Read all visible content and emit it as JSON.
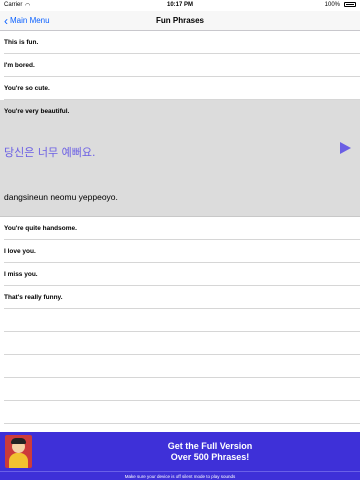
{
  "status_bar": {
    "carrier": "Carrier",
    "wifi_icon": "wifi-icon",
    "time": "10:17 PM",
    "battery": "100%"
  },
  "nav": {
    "back_label": "Main Menu",
    "title": "Fun Phrases"
  },
  "phrases_before": [
    "This is fun.",
    "I'm bored.",
    "You're so cute."
  ],
  "selected": {
    "english": "You're very beautiful.",
    "korean": "당신은 너무 예뻐요.",
    "romanization": "dangsineun neomu yeppeoyo.",
    "play_icon": "play-icon",
    "accent_color": "#6b5fe4"
  },
  "phrases_after": [
    "You're quite handsome.",
    "I love you.",
    "I miss you.",
    "That's really funny."
  ],
  "ad": {
    "line1": "Get the Full Version",
    "line2": "Over 500 Phrases!",
    "background_color": "#3e30d8"
  },
  "footer": {
    "note": "Make sure your device is off silent mode to play sounds"
  }
}
